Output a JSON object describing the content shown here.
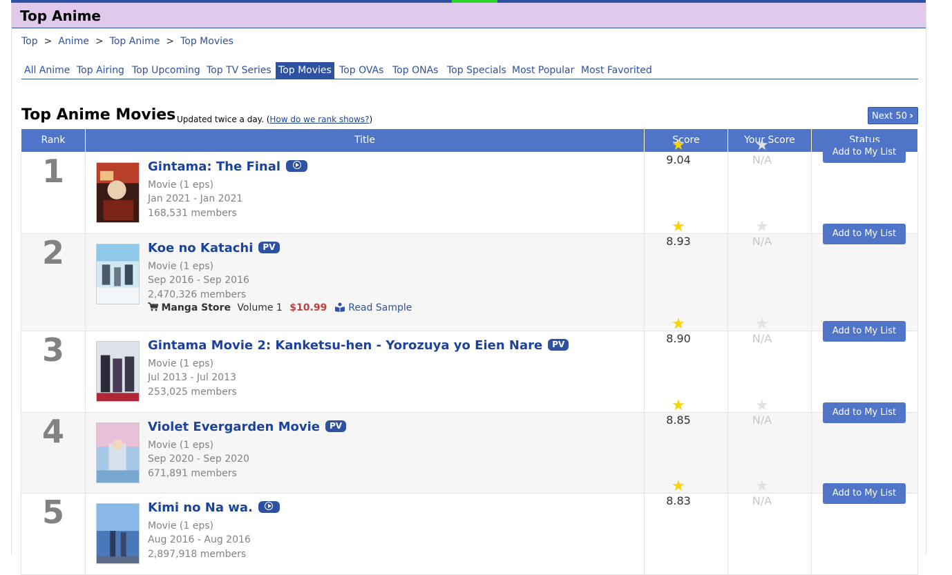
{
  "header": {
    "title": "Top Anime"
  },
  "breadcrumb": [
    "Top",
    "Anime",
    "Top Anime",
    "Top Movies"
  ],
  "tabs": [
    "All Anime",
    "Top Airing",
    "Top Upcoming",
    "Top TV Series",
    "Top Movies",
    "Top OVAs",
    "Top ONAs",
    "Top Specials",
    "Most Popular",
    "Most Favorited"
  ],
  "active_tab": "Top Movies",
  "section": {
    "title": "Top Anime Movies",
    "updated_text": "Updated twice a day. (",
    "rank_link": "How do we rank shows?",
    "updated_close": ")",
    "next_label": "Next 50"
  },
  "table": {
    "headers": {
      "rank": "Rank",
      "title": "Title",
      "score": "Score",
      "your_score": "Your Score",
      "status": "Status"
    },
    "rows": [
      {
        "rank": "1",
        "title": "Gintama: The Final",
        "badge": "play",
        "badge_label": "",
        "type": "Movie (1 eps)",
        "dates": "Jan 2021 - Jan 2021",
        "members": "168,531 members",
        "score": "9.04",
        "your_score": "N/A",
        "button": "Add to My List"
      },
      {
        "rank": "2",
        "title": "Koe no Katachi",
        "badge": "pv",
        "badge_label": "PV",
        "type": "Movie (1 eps)",
        "dates": "Sep 2016 - Sep 2016",
        "members": "2,470,326 members",
        "score": "8.93",
        "your_score": "N/A",
        "button": "Add to My List",
        "store": {
          "name": "Manga Store",
          "volume": "Volume 1",
          "price": "$10.99",
          "sample": "Read Sample"
        }
      },
      {
        "rank": "3",
        "title": "Gintama Movie 2: Kanketsu-hen - Yorozuya yo Eien Nare",
        "badge": "pv",
        "badge_label": "PV",
        "type": "Movie (1 eps)",
        "dates": "Jul 2013 - Jul 2013",
        "members": "253,025 members",
        "score": "8.90",
        "your_score": "N/A",
        "button": "Add to My List"
      },
      {
        "rank": "4",
        "title": "Violet Evergarden Movie",
        "badge": "pv",
        "badge_label": "PV",
        "type": "Movie (1 eps)",
        "dates": "Sep 2020 - Sep 2020",
        "members": "671,891 members",
        "score": "8.85",
        "your_score": "N/A",
        "button": "Add to My List"
      },
      {
        "rank": "5",
        "title": "Kimi no Na wa.",
        "badge": "play",
        "badge_label": "",
        "type": "Movie (1 eps)",
        "dates": "Aug 2016 - Aug 2016",
        "members": "2,897,918 members",
        "score": "8.83",
        "your_score": "N/A",
        "button": "Add to My List"
      }
    ]
  },
  "icons": {
    "star_filled": "star-icon",
    "star_empty": "empty-star-icon",
    "cart": "cart-icon",
    "book": "book-icon",
    "play": "play-icon",
    "chevron": "chevron-right-icon"
  },
  "colors": {
    "accent": "#2e51a2",
    "header_bg": "#e1c9ec",
    "button": "#4f74c8",
    "price": "#c13e3e",
    "star": "#f7d400"
  }
}
